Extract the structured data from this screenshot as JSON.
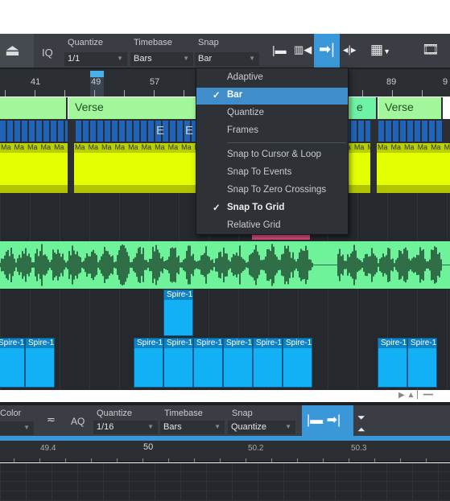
{
  "toolbar": {
    "iq": "IQ",
    "quantize_label": "Quantize",
    "quantize": "1/1",
    "timebase_label": "Timebase",
    "timebase": "Bars",
    "snap_label": "Snap",
    "snap": "Bar"
  },
  "ruler": {
    "bars": [
      "41",
      "49",
      "57",
      "89",
      "9"
    ]
  },
  "arranger": [
    {
      "label": ""
    },
    {
      "label": "Verse"
    },
    {
      "label": "e"
    },
    {
      "label": "Verse"
    }
  ],
  "chord_labels": [
    "E",
    "E"
  ],
  "clip_label": "Ma",
  "instrument_clip": "Spire-1",
  "snap_menu": {
    "items": [
      {
        "label": "Adaptive",
        "checked": false
      },
      {
        "label": "Bar",
        "checked": true,
        "highlighted": true
      },
      {
        "label": "Quantize",
        "checked": false
      },
      {
        "label": "Frames",
        "checked": false
      },
      {
        "label": "Snap to Cursor & Loop",
        "checked": false
      },
      {
        "label": "Snap To Events",
        "checked": false
      },
      {
        "label": "Snap To Zero Crossings",
        "checked": false
      },
      {
        "label": "Snap To Grid",
        "checked": true
      },
      {
        "label": "Relative Grid",
        "checked": false
      }
    ],
    "check": "✓"
  },
  "editor_toolbar": {
    "color_label": "Color",
    "aq": "AQ",
    "quantize_label": "Quantize",
    "quantize": "1/16",
    "timebase_label": "Timebase",
    "timebase": "Bars",
    "snap_label": "Snap",
    "snap": "Quantize"
  },
  "editor_ruler": {
    "marks": [
      "49.4",
      "50",
      "50.2",
      "50.3"
    ]
  },
  "colors": {
    "accent": "#3a98d8",
    "arranger": "#a2f79c",
    "yellow_track": "#e3ff00",
    "audio": "#6ef39a",
    "instrument": "#12b0f5"
  }
}
